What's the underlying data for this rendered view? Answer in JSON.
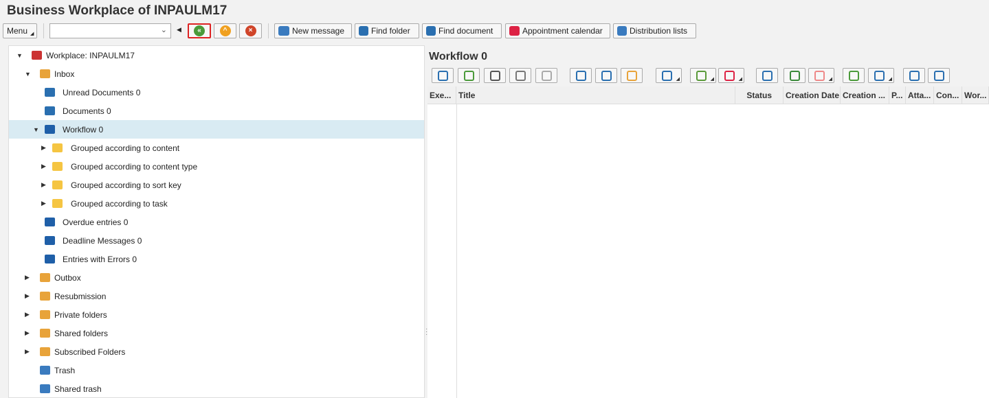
{
  "title": "Business Workplace of INPAULM17",
  "toolbar": {
    "menu": "Menu",
    "command_value": "",
    "new_message": "New message",
    "find_folder": "Find folder",
    "find_document": "Find document",
    "appointment_calendar": "Appointment calendar",
    "distribution_lists": "Distribution lists"
  },
  "tree": [
    {
      "label": "Workplace: INPAULM17",
      "level": 0,
      "toggle": "down",
      "icon": "workplace-icon",
      "color": "#c33"
    },
    {
      "label": "Inbox",
      "level": 1,
      "toggle": "down",
      "icon": "inbox-icon",
      "color": "#e8a33a"
    },
    {
      "label": "Unread Documents 0",
      "level": 2,
      "toggle": "",
      "icon": "document-list-icon",
      "color": "#2a6fb0"
    },
    {
      "label": "Documents 0",
      "level": 2,
      "toggle": "",
      "icon": "document-list-icon",
      "color": "#2a6fb0"
    },
    {
      "label": "Workflow 0",
      "level": 2,
      "toggle": "down",
      "icon": "workflow-icon",
      "color": "#1f5fa8",
      "selected": true
    },
    {
      "label": "Grouped according to content",
      "level": 3,
      "toggle": "right",
      "icon": "folder-icon",
      "color": "#f5c542"
    },
    {
      "label": "Grouped according to content type",
      "level": 3,
      "toggle": "right",
      "icon": "folder-icon",
      "color": "#f5c542"
    },
    {
      "label": "Grouped according to sort key",
      "level": 3,
      "toggle": "right",
      "icon": "folder-icon",
      "color": "#f5c542"
    },
    {
      "label": "Grouped according to task",
      "level": 3,
      "toggle": "right",
      "icon": "folder-icon",
      "color": "#f5c542"
    },
    {
      "label": "Overdue entries 0",
      "level": 2,
      "toggle": "",
      "icon": "workflow-icon",
      "color": "#1f5fa8"
    },
    {
      "label": "Deadline Messages 0",
      "level": 2,
      "toggle": "",
      "icon": "workflow-icon",
      "color": "#1f5fa8"
    },
    {
      "label": "Entries with Errors 0",
      "level": 2,
      "toggle": "",
      "icon": "workflow-icon",
      "color": "#1f5fa8"
    },
    {
      "label": "Outbox",
      "level": 1,
      "toggle": "right",
      "icon": "outbox-icon",
      "color": "#e8a33a"
    },
    {
      "label": "Resubmission",
      "level": 1,
      "toggle": "right",
      "icon": "resubmission-icon",
      "color": "#e8a33a"
    },
    {
      "label": "Private folders",
      "level": 1,
      "toggle": "right",
      "icon": "private-folders-icon",
      "color": "#e8a33a"
    },
    {
      "label": "Shared folders",
      "level": 1,
      "toggle": "right",
      "icon": "shared-folders-icon",
      "color": "#e8a33a"
    },
    {
      "label": "Subscribed Folders",
      "level": 1,
      "toggle": "right",
      "icon": "subscribed-folders-icon",
      "color": "#e8a33a"
    },
    {
      "label": "Trash",
      "level": 1,
      "toggle": "",
      "icon": "trash-icon",
      "color": "#3a7bbf"
    },
    {
      "label": "Shared trash",
      "level": 1,
      "toggle": "",
      "icon": "trash-icon",
      "color": "#3a7bbf"
    }
  ],
  "workflow": {
    "title": "Workflow 0",
    "columns": [
      "Exe...",
      "Title",
      "Status",
      "Creation Date",
      "Creation ...",
      "P...",
      "Atta...",
      "Con...",
      "Wor..."
    ],
    "buttons": [
      {
        "name": "refresh",
        "color": "#2a6fb0"
      },
      {
        "name": "execute",
        "color": "#4a9a3a"
      },
      {
        "name": "display",
        "color": "#555"
      },
      {
        "name": "object",
        "color": "#777"
      },
      {
        "name": "object-disabled",
        "color": "#aaa"
      },
      {
        "name": "deadline",
        "color": "#2a6fb0"
      },
      {
        "name": "priority",
        "color": "#2a6fb0"
      },
      {
        "name": "resubmit",
        "color": "#e8a33a"
      },
      {
        "name": "attachment",
        "color": "#2a6fb0",
        "dd": true
      },
      {
        "name": "add-to-folder",
        "color": "#5a9a3a",
        "dd": true
      },
      {
        "name": "layout",
        "color": "#d24",
        "dd": true
      },
      {
        "name": "print",
        "color": "#2a6fb0"
      },
      {
        "name": "preview",
        "color": "#3a8a3a"
      },
      {
        "name": "columns",
        "color": "#e88",
        "dd": true
      },
      {
        "name": "sum",
        "color": "#4a9a3a"
      },
      {
        "name": "filter",
        "color": "#2a6fb0",
        "dd": true
      },
      {
        "name": "find",
        "color": "#2a6fb0"
      },
      {
        "name": "copy",
        "color": "#2a6fb0"
      }
    ]
  }
}
